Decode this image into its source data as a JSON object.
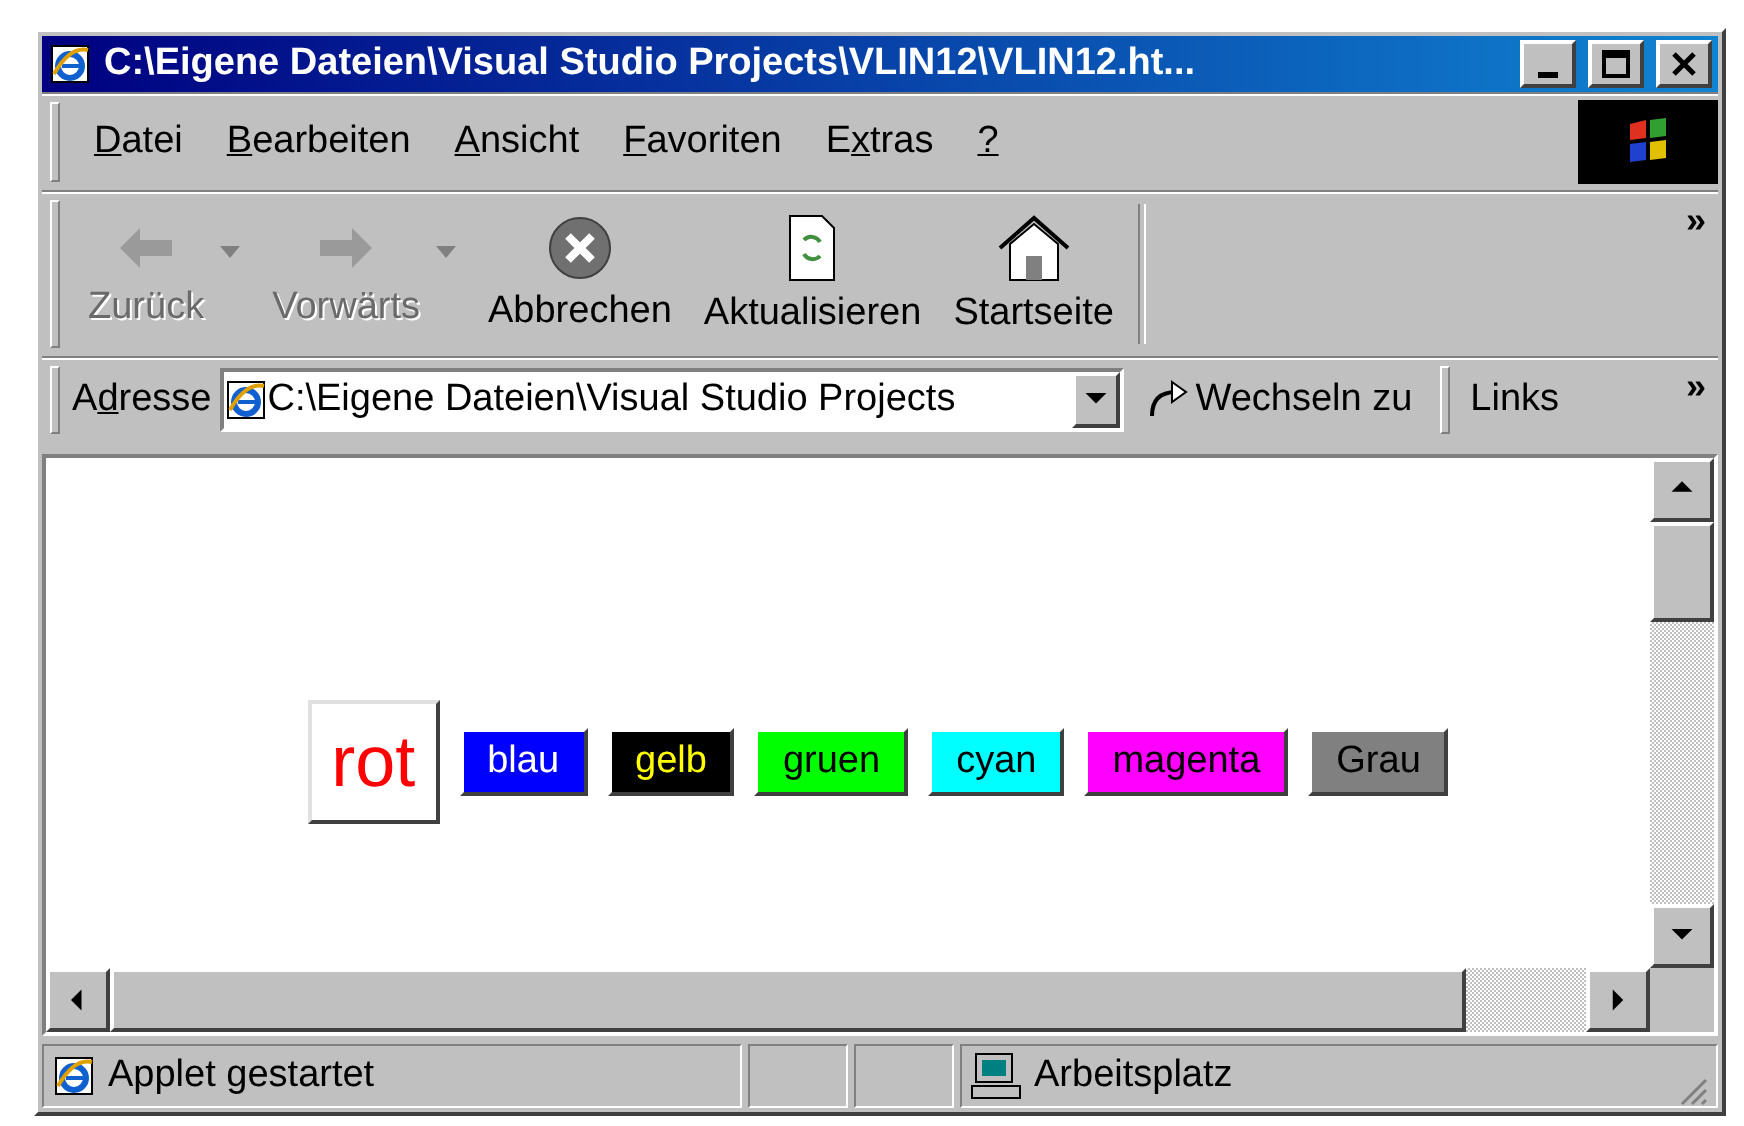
{
  "window": {
    "title": "C:\\Eigene Dateien\\Visual Studio Projects\\VLIN12\\VLIN12.ht..."
  },
  "menu": [
    {
      "key": "D",
      "rest": "atei"
    },
    {
      "key": "B",
      "rest": "earbeiten"
    },
    {
      "key": "A",
      "rest": "nsicht"
    },
    {
      "key": "F",
      "rest": "avoriten"
    },
    {
      "before": "E",
      "key": "x",
      "rest": "tras"
    },
    {
      "key": "?"
    }
  ],
  "toolbar_more": "»",
  "toolbar": [
    {
      "kind": "back",
      "label": "Zurück",
      "disabled": true,
      "dropdown": true
    },
    {
      "kind": "forward",
      "label": "Vorwärts",
      "disabled": true,
      "dropdown": true
    },
    {
      "kind": "stop",
      "label": "Abbrechen",
      "disabled": false,
      "dropdown": false
    },
    {
      "kind": "refresh",
      "label": "Aktualisieren",
      "disabled": false,
      "dropdown": false
    },
    {
      "kind": "home",
      "label": "Startseite",
      "disabled": false,
      "dropdown": false
    }
  ],
  "address": {
    "label": {
      "before": "A",
      "key": "d",
      "rest": "resse"
    },
    "links_more": "»",
    "value": "C:\\Eigene Dateien\\Visual Studio Projects",
    "go": "Wechseln zu",
    "links": "Links"
  },
  "color_buttons": [
    {
      "label": "rot",
      "color": "#ffffff",
      "text": {
        "color": "#ff0000"
      },
      "selected": true
    },
    {
      "label": "blau",
      "color": "#0000ff",
      "text": {
        "color": "#ffffff"
      },
      "selected": false
    },
    {
      "label": "gelb",
      "color": "#000000",
      "text": {
        "color": "#ffff00"
      },
      "selected": false
    },
    {
      "label": "gruen",
      "color": "#00ff00",
      "text": {
        "color": "#000000"
      },
      "selected": false
    },
    {
      "label": "cyan",
      "color": "#00ffff",
      "text": {
        "color": "#000000"
      },
      "selected": false
    },
    {
      "label": "magenta",
      "color": "#ff00ff",
      "text": {
        "color": "#000000"
      },
      "selected": false
    },
    {
      "label": "Grau",
      "color": "#808080",
      "text": {
        "color": "#000000"
      },
      "selected": false
    }
  ],
  "status_bar": {
    "message": "Applet gestartet",
    "zone": "Arbeitsplatz"
  }
}
